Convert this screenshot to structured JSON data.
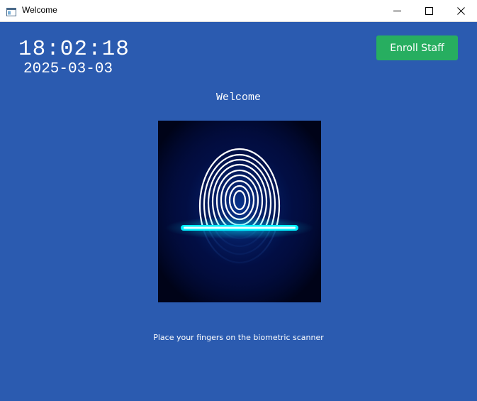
{
  "window": {
    "title": "Welcome",
    "icon": "app-window-icon",
    "controls": {
      "minimize_icon": "minimize-icon",
      "maximize_icon": "maximize-icon",
      "close_icon": "close-icon"
    }
  },
  "clock": {
    "time": "18:02:18",
    "date": "2025-03-03"
  },
  "enroll_button": {
    "label": "Enroll Staff"
  },
  "welcome": {
    "heading": "Welcome"
  },
  "scanner": {
    "image": "fingerprint-scan-illustration",
    "instruction": "Place your fingers on the biometric scanner"
  },
  "colors": {
    "background": "#2b5bb0",
    "button": "#27ae60",
    "scan_line": "#00f0ff",
    "scanner_bg": "#000318"
  }
}
